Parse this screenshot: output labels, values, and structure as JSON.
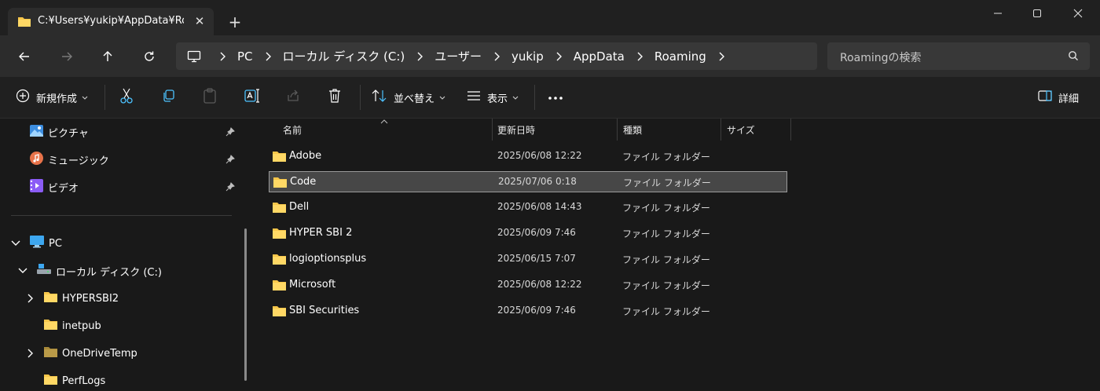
{
  "window": {
    "tab_title": "C:¥Users¥yukip¥AppData¥Roaming",
    "tab_close": "✕",
    "new_tab": "+"
  },
  "address": {
    "crumbs": [
      "PC",
      "ローカル ディスク (C:)",
      "ユーザー",
      "yukip",
      "AppData",
      "Roaming"
    ]
  },
  "search": {
    "placeholder": "Roamingの検索"
  },
  "toolbar": {
    "new_label": "新規作成",
    "sort_label": "並べ替え",
    "view_label": "表示",
    "details_label": "詳細"
  },
  "sidebar": {
    "quick_access": [
      {
        "label": "ピクチャ",
        "icon": "pictures-icon"
      },
      {
        "label": "ミュージック",
        "icon": "music-icon"
      },
      {
        "label": "ビデオ",
        "icon": "videos-icon"
      }
    ],
    "pc_label": "PC",
    "drive_label": "ローカル ディスク (C:)",
    "folders": [
      "HYPERSBI2",
      "inetpub",
      "OneDriveTemp",
      "PerfLogs"
    ]
  },
  "columns": {
    "name": "名前",
    "date": "更新日時",
    "type": "種類",
    "size": "サイズ"
  },
  "files": [
    {
      "name": "Adobe",
      "date": "2025/06/08 12:22",
      "type": "ファイル フォルダー",
      "selected": false
    },
    {
      "name": "Code",
      "date": "2025/07/06 0:18",
      "type": "ファイル フォルダー",
      "selected": true
    },
    {
      "name": "Dell",
      "date": "2025/06/08 14:43",
      "type": "ファイル フォルダー",
      "selected": false
    },
    {
      "name": "HYPER SBI 2",
      "date": "2025/06/09 7:46",
      "type": "ファイル フォルダー",
      "selected": false
    },
    {
      "name": "logioptionsplus",
      "date": "2025/06/15 7:07",
      "type": "ファイル フォルダー",
      "selected": false
    },
    {
      "name": "Microsoft",
      "date": "2025/06/08 12:22",
      "type": "ファイル フォルダー",
      "selected": false
    },
    {
      "name": "SBI Securities",
      "date": "2025/06/09 7:46",
      "type": "ファイル フォルダー",
      "selected": false
    }
  ],
  "colors": {
    "folder": "#f7c64a",
    "accent": "#4cc2ff",
    "selected_row": "#474747"
  }
}
